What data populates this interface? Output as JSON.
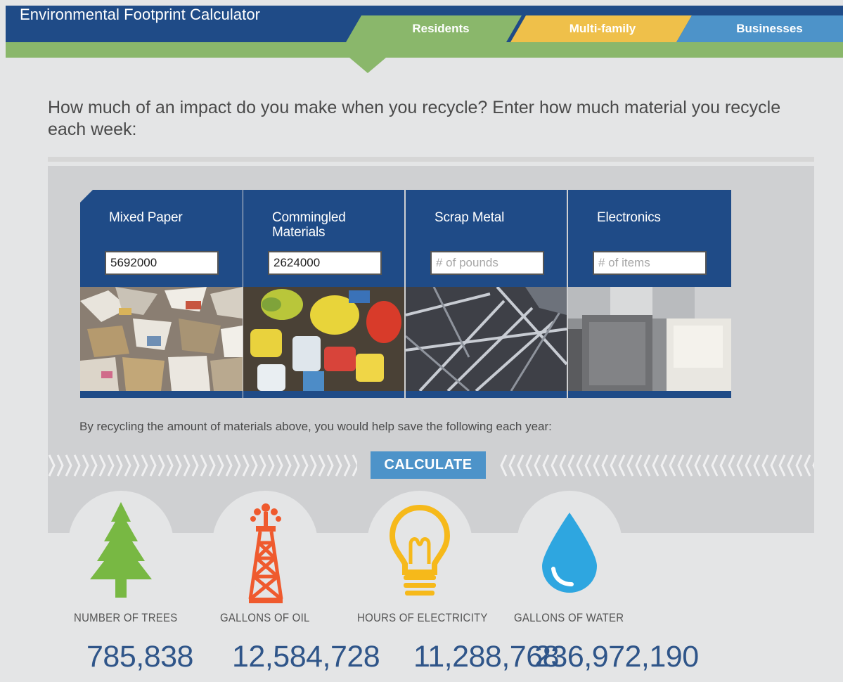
{
  "header": {
    "title": "Environmental Footprint Calculator",
    "tabs": [
      {
        "label": "Residents",
        "color": "#8ab76b",
        "active": true
      },
      {
        "label": "Multi-family",
        "color": "#efc04a",
        "active": false
      },
      {
        "label": "Businesses",
        "color": "#4d93c9",
        "active": false
      }
    ]
  },
  "question": "How much of an impact do you make when you recycle? Enter how much material you recycle each week:",
  "materials": [
    {
      "label": "Mixed Paper",
      "value": "5692000",
      "placeholder": "",
      "photo": "mixed-paper-photo"
    },
    {
      "label": "Commingled Materials",
      "value": "2624000",
      "placeholder": "",
      "photo": "commingled-photo"
    },
    {
      "label": "Scrap Metal",
      "value": "",
      "placeholder": "# of pounds",
      "photo": "scrap-metal-photo"
    },
    {
      "label": "Electronics",
      "value": "",
      "placeholder": "# of items",
      "photo": "electronics-photo"
    }
  ],
  "save_note": "By recycling the amount of materials above, you would help save the following each year:",
  "calculate_label": "CALCULATE",
  "results": [
    {
      "label": "NUMBER OF TREES",
      "value": "785,838",
      "icon": "tree-icon"
    },
    {
      "label": "GALLONS OF OIL",
      "value": "12,584,728",
      "icon": "oil-derrick-icon"
    },
    {
      "label": "HOURS OF ELECTRICITY",
      "value": "11,288,768",
      "icon": "light-bulb-icon"
    },
    {
      "label": "GALLONS OF WATER",
      "value": "236,972,190",
      "icon": "water-drop-icon"
    }
  ],
  "colors": {
    "brand_blue": "#1f4b87",
    "green": "#8ab76b",
    "yellow": "#efc04a",
    "light_blue": "#4d93c9",
    "tree": "#78b843",
    "oil": "#ef5a2e",
    "bulb": "#f6b91a",
    "water": "#2ea6e0",
    "value_text": "#2f5589"
  }
}
